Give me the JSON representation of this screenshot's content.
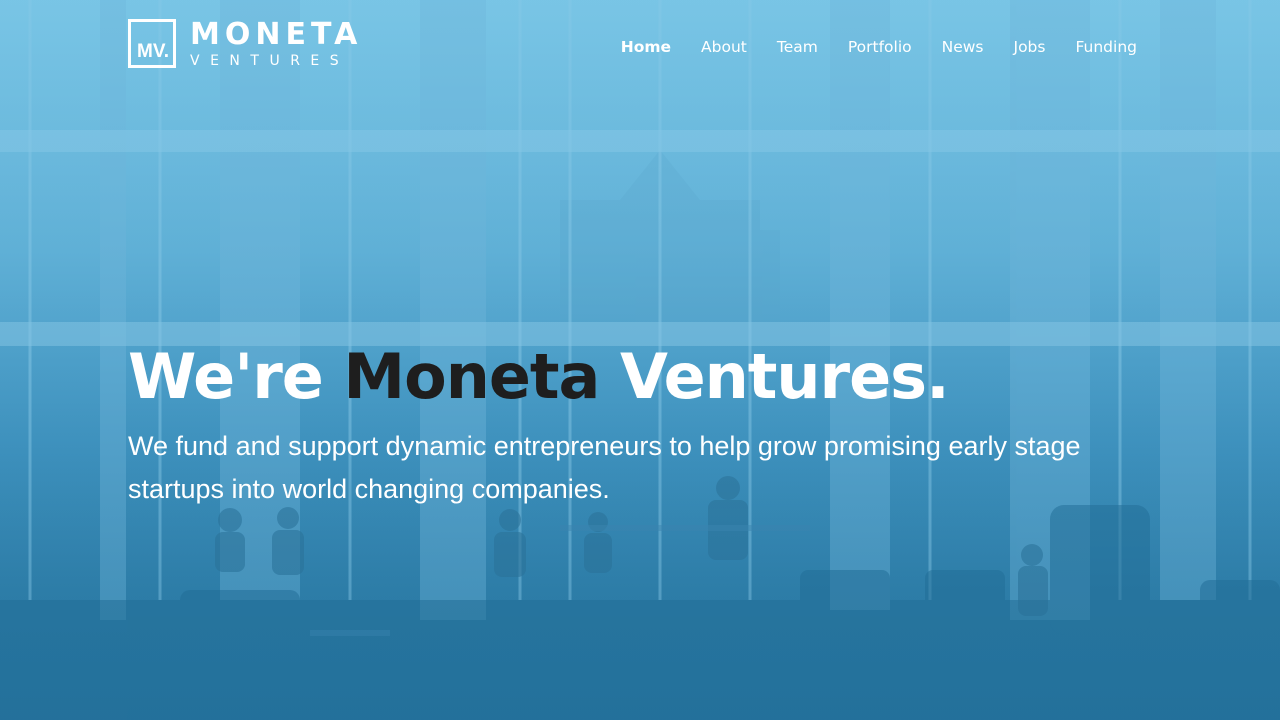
{
  "logo": {
    "mark": "MV.",
    "name": "MONETA",
    "sub": "VENTURES"
  },
  "nav": {
    "items": [
      {
        "label": "Home",
        "active": true
      },
      {
        "label": "About"
      },
      {
        "label": "Team"
      },
      {
        "label": "Portfolio"
      },
      {
        "label": "News"
      },
      {
        "label": "Jobs"
      },
      {
        "label": "Funding"
      }
    ]
  },
  "hero": {
    "headline_part1": "We're ",
    "headline_brand": "Moneta",
    "headline_part2": " Ventures.",
    "subheadline": "We fund and support dynamic entrepreneurs to help grow promising early stage startups into world changing companies."
  },
  "colors": {
    "text": "#ffffff",
    "headline_accent": "#1e1e1e",
    "background_top": "#79c4e4",
    "background_bottom": "#2a77a0"
  }
}
